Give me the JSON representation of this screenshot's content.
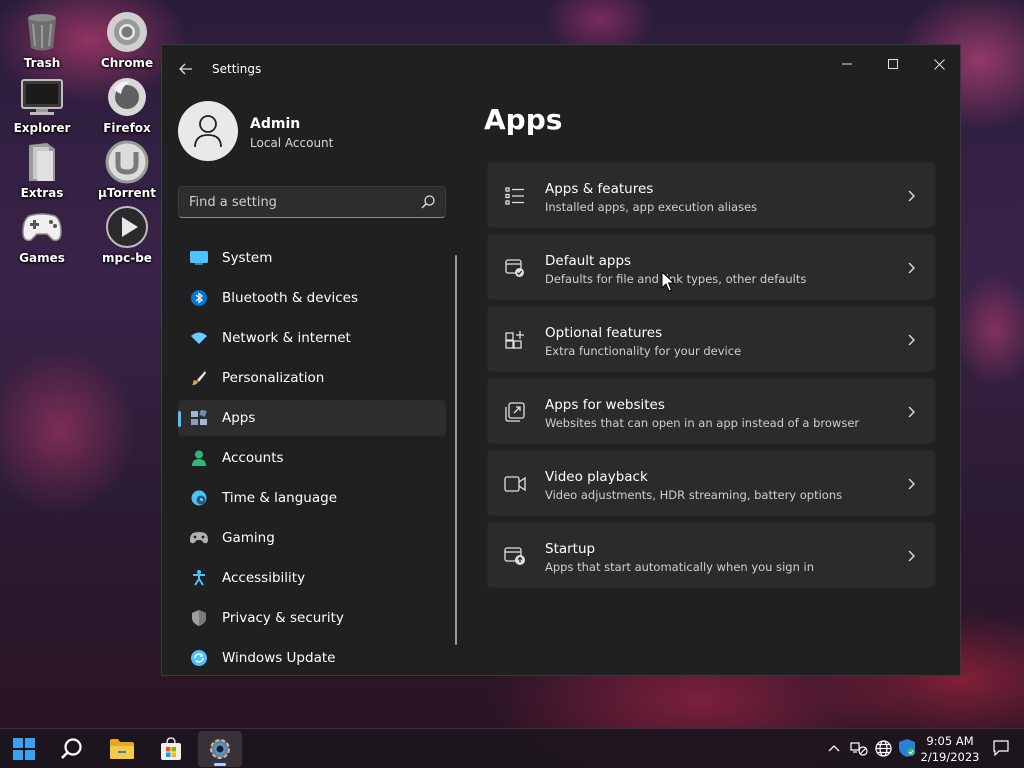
{
  "desktop": {
    "icons": [
      {
        "label": "Trash",
        "icon": "trash-icon"
      },
      {
        "label": "Chrome",
        "icon": "chrome-icon"
      },
      {
        "label": "Explorer",
        "icon": "monitor-icon"
      },
      {
        "label": "Firefox",
        "icon": "firefox-icon"
      },
      {
        "label": "Extras",
        "icon": "extras-icon"
      },
      {
        "label": "µTorrent",
        "icon": "utorrent-icon"
      },
      {
        "label": "Games",
        "icon": "gamepad-icon"
      },
      {
        "label": "mpc-be",
        "icon": "play-icon"
      }
    ]
  },
  "window": {
    "title": "Settings",
    "controls": [
      "minimize-icon",
      "maximize-icon",
      "close-icon"
    ]
  },
  "profile": {
    "name": "Admin",
    "account_type": "Local Account"
  },
  "search": {
    "placeholder": "Find a setting"
  },
  "nav": {
    "items": [
      {
        "label": "System",
        "icon": "system-icon",
        "color": "#4cc2ff"
      },
      {
        "label": "Bluetooth & devices",
        "icon": "bluetooth-icon",
        "color": "#0078d4"
      },
      {
        "label": "Network & internet",
        "icon": "wifi-icon",
        "color": "#6ccbff"
      },
      {
        "label": "Personalization",
        "icon": "brush-icon",
        "color": "#e8a04c"
      },
      {
        "label": "Apps",
        "icon": "apps-icon",
        "color": "#a4b6d4",
        "active": true
      },
      {
        "label": "Accounts",
        "icon": "person-icon",
        "color": "#2fb67a"
      },
      {
        "label": "Time & language",
        "icon": "clock-globe-icon",
        "color": "#4cc2ff"
      },
      {
        "label": "Gaming",
        "icon": "gamepad-icon",
        "color": "#b0b0b0"
      },
      {
        "label": "Accessibility",
        "icon": "accessibility-icon",
        "color": "#4cc2ff"
      },
      {
        "label": "Privacy & security",
        "icon": "shield-icon",
        "color": "#9e9e9e"
      },
      {
        "label": "Windows Update",
        "icon": "update-icon",
        "color": "#4cc2ff"
      }
    ]
  },
  "page": {
    "title": "Apps"
  },
  "cards": [
    {
      "title": "Apps & features",
      "subtitle": "Installed apps, app execution aliases",
      "icon": "list-icon"
    },
    {
      "title": "Default apps",
      "subtitle": "Defaults for file and link types, other defaults",
      "icon": "default-apps-icon"
    },
    {
      "title": "Optional features",
      "subtitle": "Extra functionality for your device",
      "icon": "add-grid-icon"
    },
    {
      "title": "Apps for websites",
      "subtitle": "Websites that can open in an app instead of a browser",
      "icon": "open-link-icon"
    },
    {
      "title": "Video playback",
      "subtitle": "Video adjustments, HDR streaming, battery options",
      "icon": "video-icon"
    },
    {
      "title": "Startup",
      "subtitle": "Apps that start automatically when you sign in",
      "icon": "startup-icon"
    }
  ],
  "taskbar": {
    "apps": [
      "start-icon",
      "search-icon",
      "file-explorer-icon",
      "store-icon",
      "settings-icon"
    ],
    "tray": [
      "chevron-up-icon",
      "network-off-icon",
      "globe-icon",
      "security-icon"
    ],
    "time": "9:05 AM",
    "date": "2/19/2023",
    "notifications": "notification-icon"
  }
}
